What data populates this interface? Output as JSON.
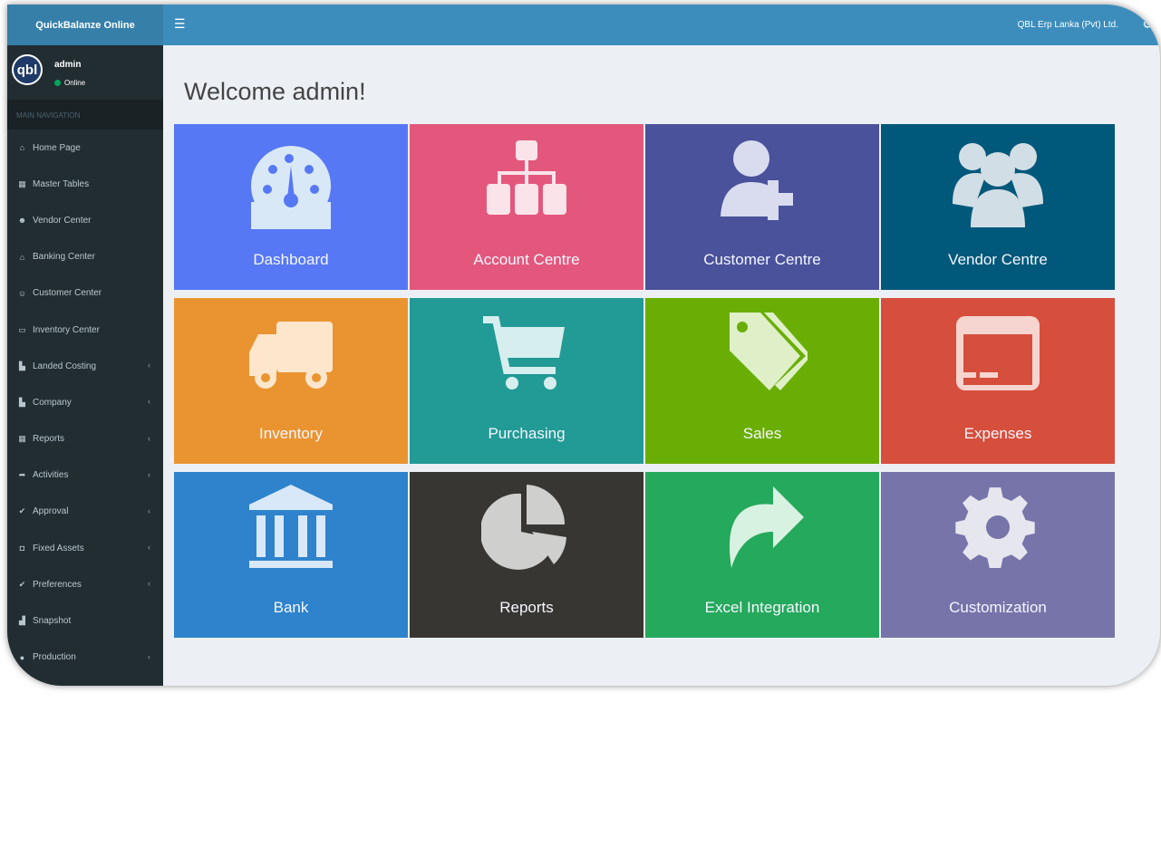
{
  "app": {
    "brand": "QuickBalanze Online",
    "company": "QBL Erp Lanka (Pvt) Ltd."
  },
  "user": {
    "avatar_text": "qbl",
    "name": "admin",
    "status": "Online"
  },
  "nav": {
    "header": "MAIN NAVIGATION",
    "items": [
      {
        "label": "Home Page",
        "icon": "home-icon",
        "chevron": false
      },
      {
        "label": "Master Tables",
        "icon": "grid-icon",
        "chevron": false
      },
      {
        "label": "Vendor Center",
        "icon": "users-icon",
        "chevron": false
      },
      {
        "label": "Banking Center",
        "icon": "bank-icon",
        "chevron": false
      },
      {
        "label": "Customer Center",
        "icon": "user-plus-icon",
        "chevron": false
      },
      {
        "label": "Inventory Center",
        "icon": "archive-icon",
        "chevron": false
      },
      {
        "label": "Landed Costing",
        "icon": "bar-chart-icon",
        "chevron": true
      },
      {
        "label": "Company",
        "icon": "bar-chart-icon",
        "chevron": true
      },
      {
        "label": "Reports",
        "icon": "grid-icon",
        "chevron": true
      },
      {
        "label": "Activities",
        "icon": "share-icon",
        "chevron": true
      },
      {
        "label": "Approval",
        "icon": "thumbs-up-icon",
        "chevron": true
      },
      {
        "label": "Fixed Assets",
        "icon": "car-icon",
        "chevron": true
      },
      {
        "label": "Preferences",
        "icon": "thumbs-up-icon",
        "chevron": true
      },
      {
        "label": "Snapshot",
        "icon": "area-chart-icon",
        "chevron": false
      },
      {
        "label": "Production",
        "icon": "product-hunt-icon",
        "chevron": true
      }
    ]
  },
  "main": {
    "welcome": "Welcome admin!",
    "tiles": [
      {
        "label": "Dashboard",
        "icon": "dashboard-icon",
        "color": "#5778f5"
      },
      {
        "label": "Account Centre",
        "icon": "sitemap-icon",
        "color": "#e3577d"
      },
      {
        "label": "Customer Centre",
        "icon": "user-plus-icon",
        "color": "#4a529c"
      },
      {
        "label": "Vendor Centre",
        "icon": "users-icon",
        "color": "#00587a"
      },
      {
        "label": "Inventory",
        "icon": "truck-icon",
        "color": "#ea9431"
      },
      {
        "label": "Purchasing",
        "icon": "shopping-cart-icon",
        "color": "#229a95"
      },
      {
        "label": "Sales",
        "icon": "tags-icon",
        "color": "#6aae05"
      },
      {
        "label": "Expenses",
        "icon": "credit-card-icon",
        "color": "#d64e3c"
      },
      {
        "label": "Bank",
        "icon": "bank-icon",
        "color": "#2e83cc"
      },
      {
        "label": "Reports",
        "icon": "pie-chart-icon",
        "color": "#383632"
      },
      {
        "label": "Excel Integration",
        "icon": "share-icon",
        "color": "#25a95c"
      },
      {
        "label": "Customization",
        "icon": "gear-icon",
        "color": "#7774aa"
      }
    ]
  }
}
